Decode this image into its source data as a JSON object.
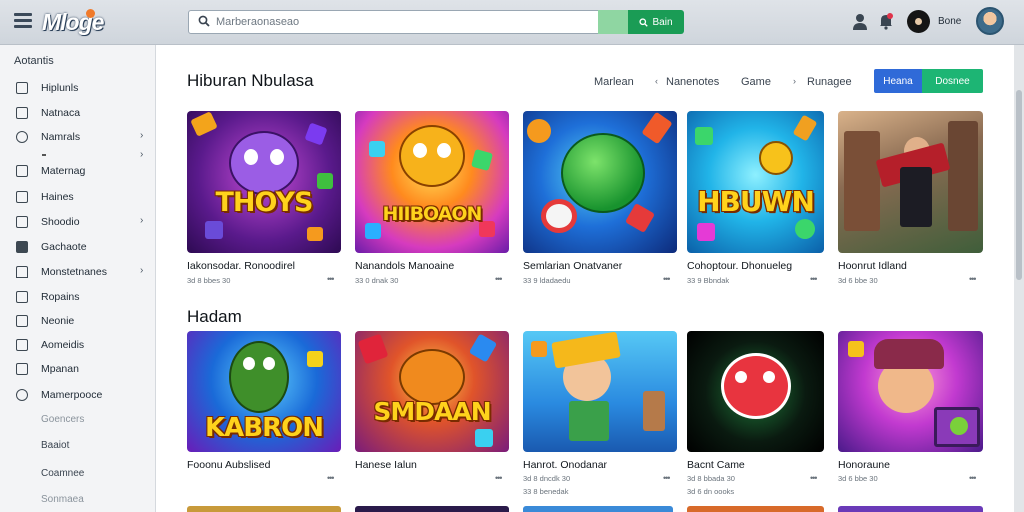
{
  "header": {
    "logo": "Mloge",
    "search_placeholder": "Marberaonaseao",
    "search_button": "Bain",
    "user_name": "Bone"
  },
  "sidebar": {
    "heading": "Aotantis",
    "items": [
      {
        "label": "Hiplunls",
        "icon": "monitor-icon",
        "chevron": false
      },
      {
        "label": "Natnaca",
        "icon": "mail-icon",
        "chevron": false
      },
      {
        "label": "Namrals",
        "icon": "clock-icon",
        "chevron": true
      },
      {
        "label": "Maternag",
        "icon": "bag-icon",
        "chevron": false
      },
      {
        "label": "Haines",
        "icon": "card-icon",
        "chevron": false
      },
      {
        "label": "Shoodio",
        "icon": "grid-icon",
        "chevron": true
      },
      {
        "label": "Gachaote",
        "icon": "image-icon",
        "chevron": false
      },
      {
        "label": "Monstetnanes",
        "icon": "home-icon",
        "chevron": true
      },
      {
        "label": "Ropains",
        "icon": "book-icon",
        "chevron": false
      },
      {
        "label": "Neonie",
        "icon": "square-icon",
        "chevron": false
      },
      {
        "label": "Aomeidis",
        "icon": "screen-icon",
        "chevron": false
      },
      {
        "label": "Mpanan",
        "icon": "folder-icon",
        "chevron": false
      },
      {
        "label": "Mamerpooce",
        "icon": "gear-icon",
        "chevron": false
      }
    ],
    "sub_items": [
      "Goencers",
      "Baaiot",
      "Coamnee",
      "Sonmaea"
    ]
  },
  "main": {
    "section1_title": "Hiburan Nbulasa",
    "filters": [
      "Marlean",
      "Nanenotes",
      "Game",
      "Runagee"
    ],
    "btn_blue": "Heana",
    "btn_green": "Dosnee",
    "row1": [
      {
        "title": "Iakonsodar. Ronoodirel",
        "meta": "3d 8 bbes 30",
        "thumb_text": "THOYS"
      },
      {
        "title": "Nanandols Manoaine",
        "meta": "33 0 dnak 30",
        "thumb_text": "HIIBOAON"
      },
      {
        "title": "Semlarian Onatvaner",
        "meta": "33 9 ldadaedu",
        "thumb_text": ""
      },
      {
        "title": "Cohoptour. Dhonueleg",
        "meta": "33 9 Bbndak",
        "thumb_text": "HBUWN"
      },
      {
        "title": "Hoonrut Idland",
        "meta": "3d 6 bbe 30",
        "thumb_text": ""
      }
    ],
    "section2_title": "Hadam",
    "row2": [
      {
        "title": "Fooonu Aubslised",
        "meta": "",
        "thumb_text": "KABRON"
      },
      {
        "title": "Hanese Ialun",
        "meta": "",
        "thumb_text": "SMDAAN"
      },
      {
        "title": "Hanrot. Onodanar",
        "meta": "3d 8 dncdk 30",
        "meta2": "33 8 benedak",
        "thumb_text": ""
      },
      {
        "title": "Bacnt Came",
        "meta": "3d 8 bbada 30",
        "meta2": "3d 6 dn oooks",
        "thumb_text": ""
      },
      {
        "title": "Honoraune",
        "meta": "3d 6 bbe 30",
        "thumb_text": ""
      }
    ]
  },
  "colors": {
    "accent_green": "#1a9c55",
    "accent_blue": "#2f6ad8",
    "button_green": "#1db574"
  }
}
